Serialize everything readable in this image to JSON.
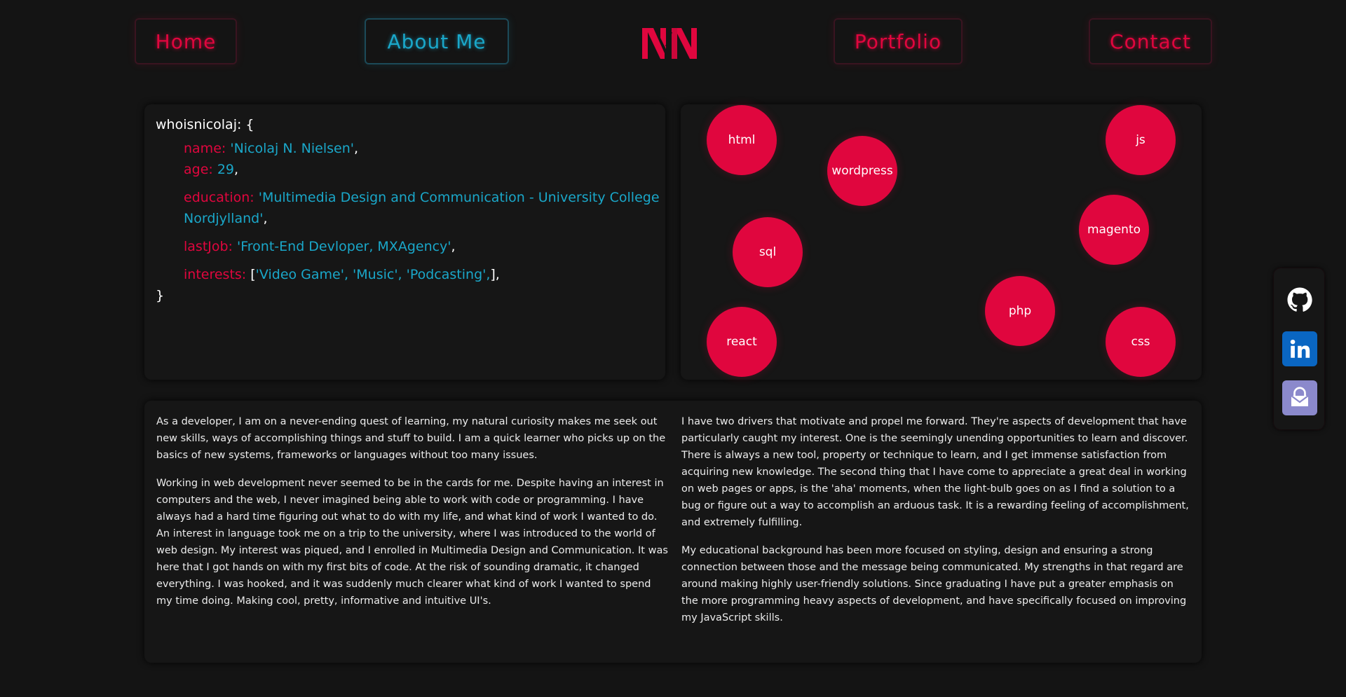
{
  "nav": {
    "home": "Home",
    "about": "About Me",
    "portfolio": "Portfolio",
    "contact": "Contact",
    "logo": "NN"
  },
  "code": {
    "object_name": "whoisnicolaj: {",
    "closing": "}",
    "name_key": "name:",
    "name_val": "'Nicolaj N. Nielsen'",
    "age_key": "age:",
    "age_val": "29",
    "education_key": "education:",
    "education_val_1": "'Multimedia Design and Communication - University College",
    "education_val_2": "Nordjylland'",
    "lastjob_key": "lastJob:",
    "lastjob_val": "'Front-End Devloper, MXAgency'",
    "interests_key": "interests:",
    "interests_open": "[",
    "interests_val": "'Video Game', 'Music', 'Podcasting',",
    "interests_close": "],",
    "comma": ","
  },
  "skills": [
    "html",
    "wordpress",
    "js",
    "magento",
    "sql",
    "php",
    "react",
    "css"
  ],
  "about": {
    "left": [
      "As a developer, I am on a never-ending quest of learning, my natural curiosity makes me seek out new skills, ways of accomplishing things and stuff to build. I am a quick learner who picks up on the basics of new systems, frameworks or languages without too many issues.",
      "Working in web development never seemed to be in the cards for me. Despite having an interest in computers and the web, I never imagined being able to work with code or programming. I have always had a hard time figuring out what to do with my life, and what kind of work I wanted to do. An interest in language took me on a trip to the university, where I was introduced to the world of web design. My interest was piqued, and I enrolled in Multimedia Design and Communication. It was here that I got hands on with my first bits of code. At the risk of sounding dramatic, it changed everything. I was hooked, and it was suddenly much clearer what kind of work I wanted to spend my time doing. Making cool, pretty, informative and intuitive UI's."
    ],
    "right": [
      "I have two drivers that motivate and propel me forward. They're aspects of development that have particularly caught my interest. One is the seemingly unending opportunities to learn and discover. There is always a new tool, property or technique to learn, and I get immense satisfaction from acquiring new knowledge. The second thing that I have come to appreciate a great deal in working on web pages or apps, is the 'aha' moments, when the light-bulb goes on as I find a solution to a bug or figure out a way to accomplish an arduous task. It is a rewarding feeling of accomplishment, and extremely fulfilling.",
      "My educational background has been more focused on styling, design and ensuring a strong connection between those and the message being communicated. My strengths in that regard are around making highly user-friendly solutions. Since graduating I have put a greater emphasis on the more programming heavy aspects of development, and have specifically focused on improving my JavaScript skills."
    ]
  },
  "social": {
    "github": "github-icon",
    "linkedin": "linkedin-icon",
    "protonmail": "protonmail-icon"
  },
  "colors": {
    "accent": "#e0063e",
    "secondary": "#1aa7c9",
    "background": "#141414",
    "linkedin": "#0a66c2",
    "protonmail": "#8b89cc"
  }
}
